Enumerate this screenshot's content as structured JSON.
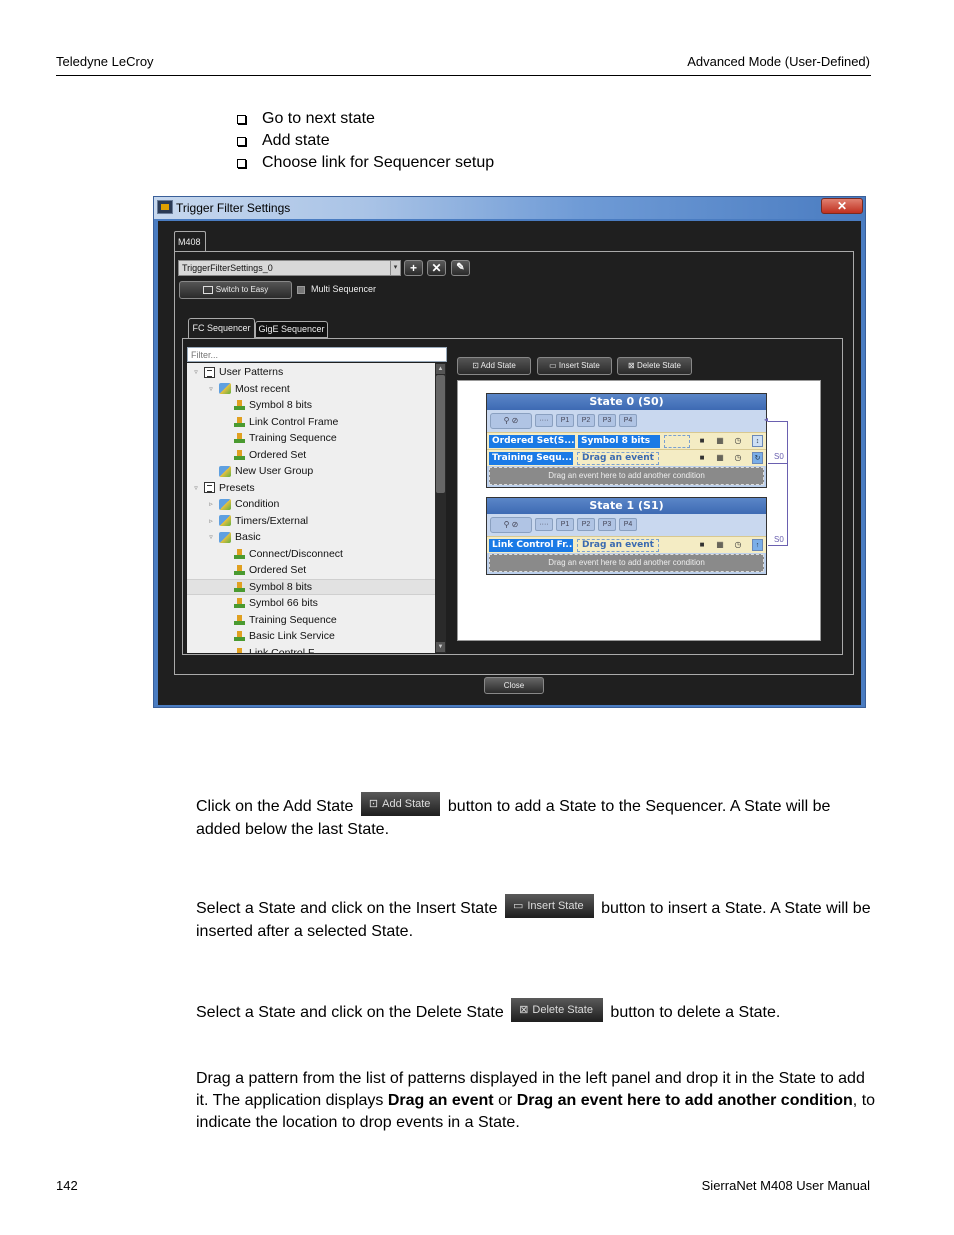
{
  "page_header": {
    "left": "Teledyne LeCroy",
    "right": "Advanced Mode (User-Defined)"
  },
  "bullets": [
    "Go to next state",
    "Add state",
    "Choose link for Sequencer setup"
  ],
  "window": {
    "title": "Trigger Filter Settings",
    "close_glyph": "✕",
    "device_tab": "M408",
    "preset_value": "TriggerFilterSettings_0",
    "add_glyph": "+",
    "delete_glyph": "✕",
    "edit_glyph": "✎",
    "switch_button": "Switch to Easy",
    "multi_sequencer_label": "Multi Sequencer",
    "multi_sequencer_checked": false,
    "seq_tabs": [
      "FC Sequencer",
      "GigE Sequencer"
    ],
    "active_seq_tab": "FC Sequencer",
    "filter_placeholder": "Filter...",
    "tree": [
      {
        "label": "User Patterns",
        "level": 0,
        "icon": "user-patterns-icon",
        "expander": "expanded"
      },
      {
        "label": "Most recent",
        "level": 1,
        "icon": "folder-icon",
        "expander": "expanded"
      },
      {
        "label": "Symbol 8 bits",
        "level": 2,
        "icon": "pattern-icon",
        "expander": "none"
      },
      {
        "label": "Link Control Frame",
        "level": 2,
        "icon": "pattern-icon",
        "expander": "none"
      },
      {
        "label": "Training Sequence",
        "level": 2,
        "icon": "pattern-icon",
        "expander": "none"
      },
      {
        "label": "Ordered Set",
        "level": 2,
        "icon": "pattern-icon",
        "expander": "none"
      },
      {
        "label": "New User Group",
        "level": 1,
        "icon": "folder-icon",
        "expander": "none"
      },
      {
        "label": "Presets",
        "level": 0,
        "icon": "list-icon",
        "expander": "expanded"
      },
      {
        "label": "Condition",
        "level": 1,
        "icon": "folder-icon",
        "expander": "collapsed"
      },
      {
        "label": "Timers/External",
        "level": 1,
        "icon": "folder-icon",
        "expander": "collapsed"
      },
      {
        "label": "Basic",
        "level": 1,
        "icon": "folder-icon",
        "expander": "expanded"
      },
      {
        "label": "Connect/Disconnect",
        "level": 2,
        "icon": "pattern-icon",
        "expander": "none"
      },
      {
        "label": "Ordered Set",
        "level": 2,
        "icon": "pattern-icon",
        "expander": "none"
      },
      {
        "label": "Symbol 8 bits",
        "level": 2,
        "icon": "pattern-icon",
        "expander": "none",
        "selected": true
      },
      {
        "label": "Symbol 66 bits",
        "level": 2,
        "icon": "pattern-icon",
        "expander": "none"
      },
      {
        "label": "Training Sequence",
        "level": 2,
        "icon": "pattern-icon",
        "expander": "none"
      },
      {
        "label": "Basic Link Service",
        "level": 2,
        "icon": "pattern-icon",
        "expander": "none"
      },
      {
        "label": "Link Control F...",
        "level": 2,
        "icon": "pattern-icon",
        "expander": "none"
      }
    ],
    "seq_buttons": {
      "add": "Add State",
      "insert": "Insert State",
      "delete": "Delete State"
    },
    "states": [
      {
        "title": "State 0 (S0)",
        "ports": [
          "P1",
          "P2",
          "P3",
          "P4"
        ],
        "conditions": [
          {
            "events": [
              "Ordered Set(S...",
              "Symbol 8 bits"
            ],
            "drop": "",
            "goto": "S0"
          },
          {
            "events": [
              "Training Sequ..."
            ],
            "drop": "Drag an event",
            "goto": "S0"
          }
        ],
        "add_condition": "Drag an event here to add another condition"
      },
      {
        "title": "State 1 (S1)",
        "ports": [
          "P1",
          "P2",
          "P3",
          "P4"
        ],
        "conditions": [
          {
            "events": [
              "Link Control Fr..."
            ],
            "drop": "Drag an event",
            "goto": "S0"
          }
        ],
        "add_condition": "Drag an event here to add another condition"
      }
    ],
    "close_button": "Close"
  },
  "paragraphs": {
    "add": {
      "before": "Click on the Add State",
      "button": "Add State",
      "after": "button to add a State to the Sequencer. A State will be added below the last State."
    },
    "insert": {
      "before": "Select a State and click on the Insert State",
      "button": "Insert State",
      "after": "button to insert a State. A State will be inserted after a selected State."
    },
    "delete": {
      "before": "Select a State and click on the Delete State",
      "button": "Delete State",
      "after": "button to delete a State."
    },
    "drag": {
      "t1": "Drag a pattern from the list of patterns displayed in the left panel and drop it in the State to add it. The application displays ",
      "b1": "Drag an event",
      "t2": " or ",
      "b2": "Drag an event here to add another condition",
      "t3": ", to indicate the location to drop events in a State."
    }
  },
  "page_footer": {
    "page_number": "142",
    "manual": "SierraNet M408 User Manual"
  }
}
